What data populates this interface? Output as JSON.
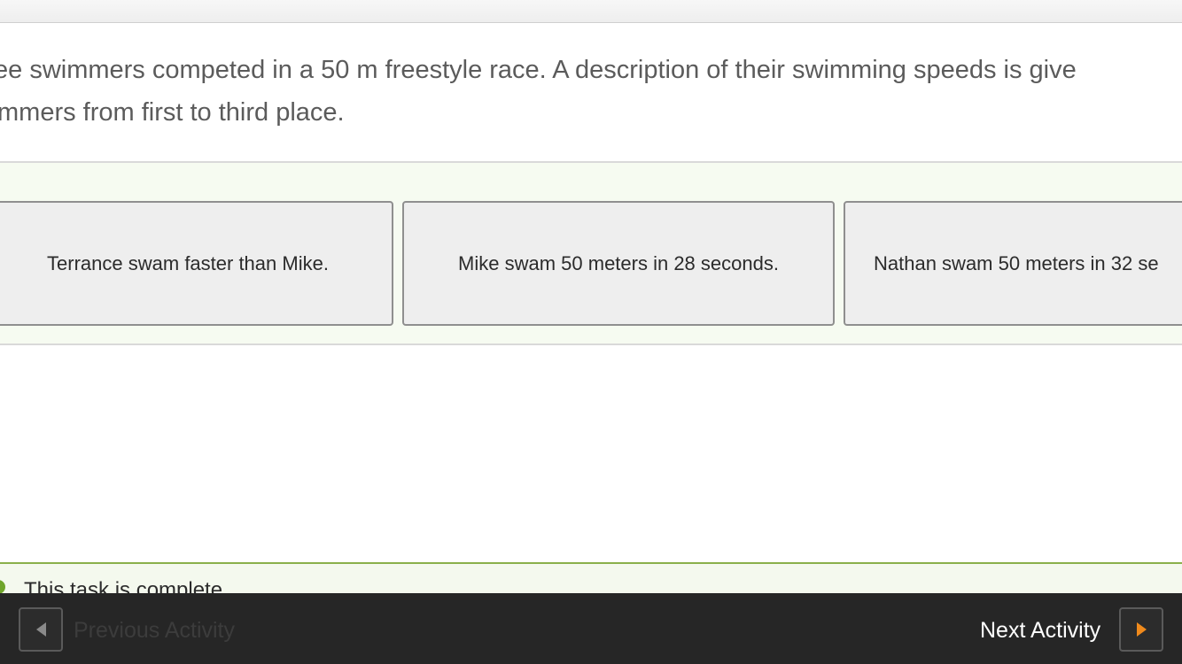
{
  "prompt": {
    "line1": "ee swimmers competed in a 50 m freestyle race. A description of their swimming speeds is give",
    "line2": "mmers from first to third place."
  },
  "cards": [
    {
      "text": "Terrance swam faster than Mike."
    },
    {
      "text": "Mike swam 50 meters in 28 seconds."
    },
    {
      "text": "Nathan swam 50 meters in 32 se"
    }
  ],
  "status": {
    "text": "This task is complete",
    "icon": "complete-check-icon",
    "color": "#6fa52b"
  },
  "footer": {
    "prev_label": "Previous Activity",
    "next_label": "Next Activity",
    "prev_icon": "arrow-left-icon",
    "next_icon": "arrow-right-icon",
    "accent": "#f08a1c"
  }
}
